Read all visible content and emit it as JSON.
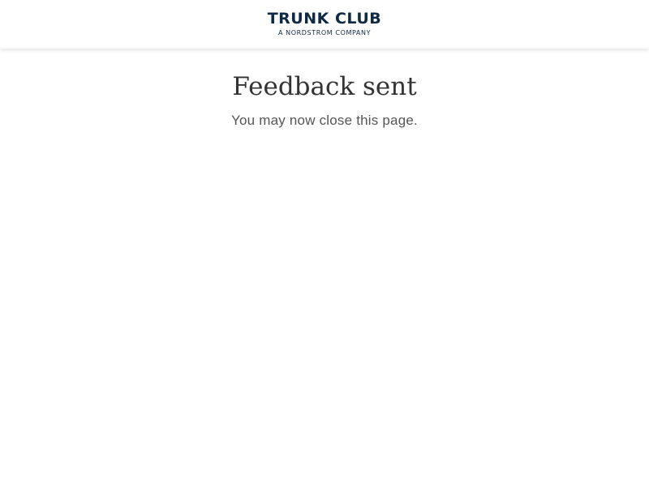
{
  "header": {
    "logo": {
      "name": "TRUNK CLUB",
      "tagline": "A NORDSTROM COMPANY"
    }
  },
  "main": {
    "title": "Feedback sent",
    "message": "You may now close this page."
  },
  "colors": {
    "brand": "#0f2a44",
    "title_text": "#333333",
    "body_text": "#555555",
    "background": "#ffffff"
  }
}
